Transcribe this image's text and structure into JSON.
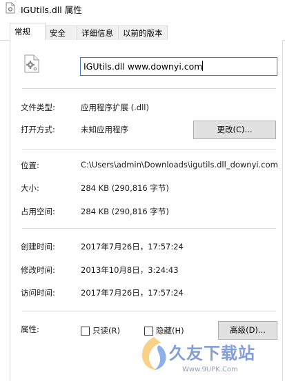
{
  "window": {
    "title": "IGUtils.dll 属性"
  },
  "tabs": [
    {
      "label": "常规",
      "active": true
    },
    {
      "label": "安全",
      "active": false
    },
    {
      "label": "详细信息",
      "active": false
    },
    {
      "label": "以前的版本",
      "active": false
    }
  ],
  "general": {
    "file_name": "IGUtils.dll www.downyi.com",
    "file_type_label": "文件类型:",
    "file_type_value": "应用程序扩展 (.dll)",
    "opens_with_label": "打开方式:",
    "opens_with_value": "未知应用程序",
    "change_button": "更改(C)...",
    "location_label": "位置:",
    "location_value": "C:\\Users\\admin\\Downloads\\igutils.dll_downyi.com",
    "size_label": "大小:",
    "size_value": "284 KB (290,816 字节)",
    "size_on_disk_label": "占用空间:",
    "size_on_disk_value": "284 KB (290,816 字节)",
    "created_label": "创建时间:",
    "created_value": "2017年7月26日，17:57:24",
    "modified_label": "修改时间:",
    "modified_value": "2013年10月8日，3:24:43",
    "accessed_label": "访问时间:",
    "accessed_value": "2017年7月26日，17:57:24",
    "attributes_label": "属性:",
    "readonly_label": "只读(R)",
    "readonly_checked": false,
    "hidden_label": "隐藏(H)",
    "hidden_checked": false,
    "advanced_button": "高级(D)..."
  },
  "watermark": {
    "text": "久友下载站",
    "url": "Www.9UPK.Com"
  },
  "colors": {
    "focus_border": "#3b78d0",
    "watermark": "#1f4fb5"
  },
  "icons": {
    "title": "dll-file-icon",
    "file": "dll-file-gear-icon"
  }
}
